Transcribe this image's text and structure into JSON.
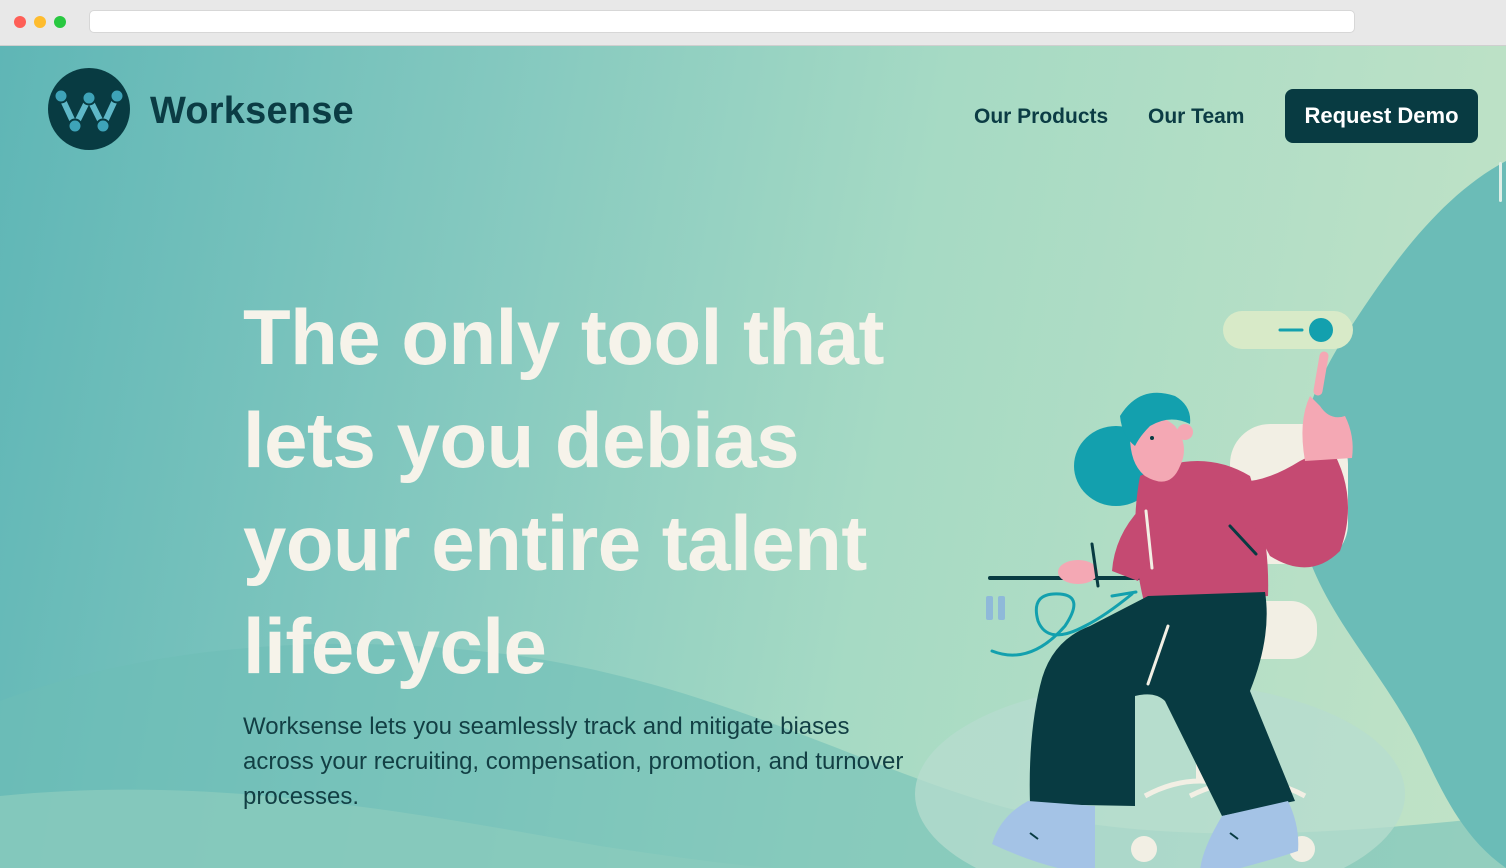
{
  "brand": {
    "name": "Worksense",
    "logo_icon": "worksense-w-logo-icon"
  },
  "nav": {
    "items": [
      {
        "label": "Our Products"
      },
      {
        "label": "Our Team"
      }
    ],
    "cta_label": "Request Demo"
  },
  "hero": {
    "title_lines": [
      "The only tool that",
      "lets you debias",
      "your entire talent",
      "lifecycle"
    ],
    "subtitle": "Worksense lets you seamlessly track and mitigate biases across your recruiting, compensation, promotion, and turnover processes.",
    "illustration": "woman-at-desk-clicking-toggle-illustration"
  },
  "colors": {
    "primary_dark": "#083b42",
    "heading_cream": "#f6f3ea",
    "teal_accent": "#13a0ae",
    "shirt_pink": "#c54a72"
  }
}
